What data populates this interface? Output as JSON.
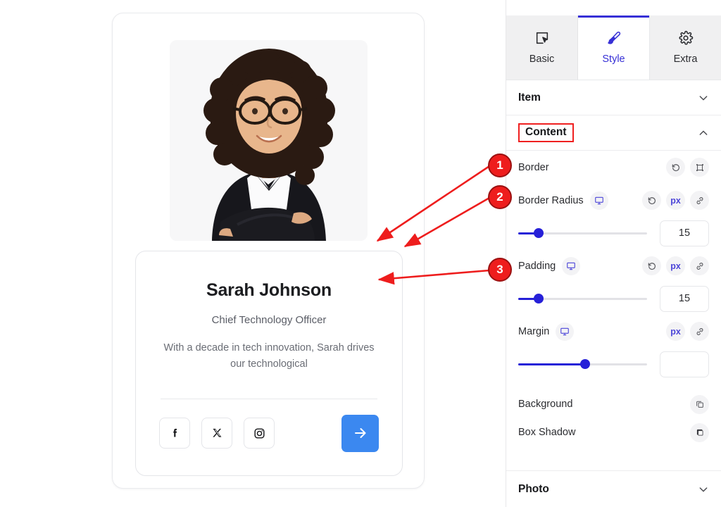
{
  "card": {
    "photo_alt": "portrait-photo",
    "name": "Sarah Johnson",
    "role": "Chief Technology Officer",
    "bio": "With a decade in tech innovation, Sarah drives our technological",
    "socials": [
      {
        "name": "facebook",
        "label": "f"
      },
      {
        "name": "x-twitter",
        "label": "X"
      },
      {
        "name": "instagram",
        "label": ""
      }
    ],
    "cta_label": "→"
  },
  "annotations": [
    {
      "number": "1",
      "target": "Border"
    },
    {
      "number": "2",
      "target": "Border Radius"
    },
    {
      "number": "3",
      "target": "Padding"
    }
  ],
  "panel": {
    "tabs": [
      {
        "label": "Basic",
        "icon": "cursor-select-icon",
        "active": false
      },
      {
        "label": "Style",
        "icon": "paint-brush-icon",
        "active": true
      },
      {
        "label": "Extra",
        "icon": "gear-icon",
        "active": false
      }
    ],
    "sections": {
      "item": {
        "label": "Item",
        "expanded": false
      },
      "content": {
        "label": "Content",
        "expanded": true,
        "highlighted": true
      },
      "photo": {
        "label": "Photo",
        "expanded": false
      }
    },
    "controls": [
      {
        "label": "Border",
        "has_device_icon": false,
        "actions": [
          "reset-icon",
          "border-frame-icon"
        ],
        "has_slider": false
      },
      {
        "label": "Border Radius",
        "has_device_icon": true,
        "actions": [
          "reset-icon",
          "px",
          "link-icon"
        ],
        "has_slider": true,
        "slider_percent": 16,
        "value": "15"
      },
      {
        "label": "Padding",
        "has_device_icon": true,
        "actions": [
          "reset-icon",
          "px",
          "link-icon"
        ],
        "has_slider": true,
        "slider_percent": 16,
        "value": "15"
      },
      {
        "label": "Margin",
        "has_device_icon": true,
        "actions": [
          "px",
          "link-icon"
        ],
        "has_slider": true,
        "slider_percent": 52,
        "value": ""
      }
    ],
    "simple_rows": [
      {
        "label": "Background",
        "icon": "copy-layers-icon"
      },
      {
        "label": "Box Shadow",
        "icon": "box-shadow-icon"
      }
    ],
    "unit_label": "px"
  },
  "colors": {
    "accent": "#3730d6",
    "slider": "#2620d8",
    "cta": "#3b88f0",
    "annotation": "#ee1d1d"
  }
}
